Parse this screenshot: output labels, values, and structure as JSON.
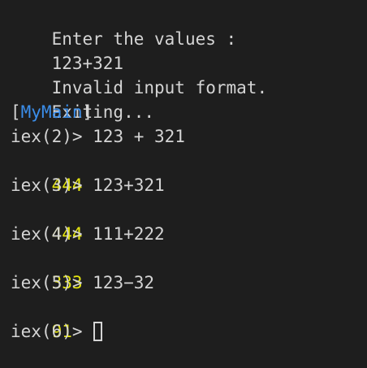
{
  "terminal": {
    "colors": {
      "background": "#1e1e1e",
      "text": "#d4d4d4",
      "result": "#e5e510",
      "module": "#3b8eea"
    },
    "lines": [
      {
        "kind": "text",
        "text": "Enter the values :"
      },
      {
        "kind": "text",
        "text": "123+321"
      },
      {
        "kind": "text",
        "text": "Invalid input format."
      },
      {
        "kind": "text",
        "text": "Exiting..."
      },
      {
        "kind": "module",
        "open": "[",
        "name": "MyMain",
        "close": "]"
      },
      {
        "kind": "prompt",
        "prompt": "iex(2)> ",
        "input": "123 + 321"
      },
      {
        "kind": "result",
        "text": "444"
      },
      {
        "kind": "prompt",
        "prompt": "iex(3)> ",
        "input": "123+321"
      },
      {
        "kind": "result",
        "text": "444"
      },
      {
        "kind": "prompt",
        "prompt": "iex(4)> ",
        "input": "111+222"
      },
      {
        "kind": "result",
        "text": "333"
      },
      {
        "kind": "prompt",
        "prompt": "iex(5)> ",
        "input": "123−32"
      },
      {
        "kind": "result",
        "text": "91"
      },
      {
        "kind": "prompt",
        "prompt": "iex(6)> ",
        "input": "",
        "cursor": true
      }
    ]
  }
}
